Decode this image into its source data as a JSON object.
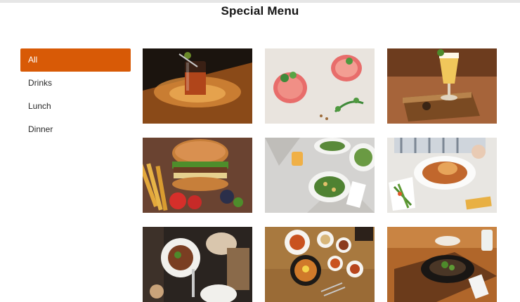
{
  "page": {
    "title": "Special Menu"
  },
  "sidebar": {
    "items": [
      {
        "label": "All",
        "active": true
      },
      {
        "label": "Drinks",
        "active": false
      },
      {
        "label": "Lunch",
        "active": false
      },
      {
        "label": "Dinner",
        "active": false
      }
    ]
  },
  "gallery": {
    "tiles": [
      {
        "name": "dark-cocktail-on-wooden-table"
      },
      {
        "name": "pink-drinks-with-mint"
      },
      {
        "name": "beer-glass-on-wooden-crate"
      },
      {
        "name": "burger-with-fries"
      },
      {
        "name": "salad-plates-on-marble"
      },
      {
        "name": "seafood-plate-dinner"
      },
      {
        "name": "dinner-table-overhead"
      },
      {
        "name": "korean-bibimbap-spread"
      },
      {
        "name": "grilled-dish-with-drink"
      }
    ]
  },
  "colors": {
    "accent": "#d85a06"
  }
}
